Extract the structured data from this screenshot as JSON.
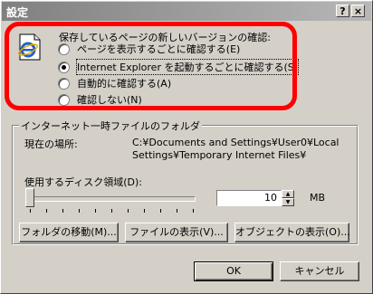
{
  "window": {
    "title": "設定",
    "help_label": "?",
    "close_label": "×"
  },
  "update_check": {
    "heading": "保存しているページの新しいバージョンの確認:",
    "options": [
      {
        "label": "ページを表示するごとに確認する(E)",
        "checked": false
      },
      {
        "label": "Internet Explorer を起動するごとに確認する(S)",
        "checked": true
      },
      {
        "label": "自動的に確認する(A)",
        "checked": false
      },
      {
        "label": "確認しない(N)",
        "checked": false
      }
    ]
  },
  "temp_files": {
    "group_title": "インターネット一時ファイルのフォルダ",
    "location_label": "現在の場所:",
    "location_value": "C:¥Documents and Settings¥User0¥Local Settings¥Temporary Internet Files¥",
    "disk_label": "使用するディスク領域(D):",
    "disk_value": "10",
    "disk_unit": "MB",
    "slider_fraction": 0.0
  },
  "buttons": {
    "move_folder": "フォルダの移動(M)...",
    "view_files": "ファイルの表示(V)...",
    "view_objects": "オブジェクトの表示(O)...",
    "ok": "OK",
    "cancel": "キャンセル"
  },
  "colors": {
    "highlight": "#ff0000",
    "dialog_bg": "#d4d0c8"
  }
}
